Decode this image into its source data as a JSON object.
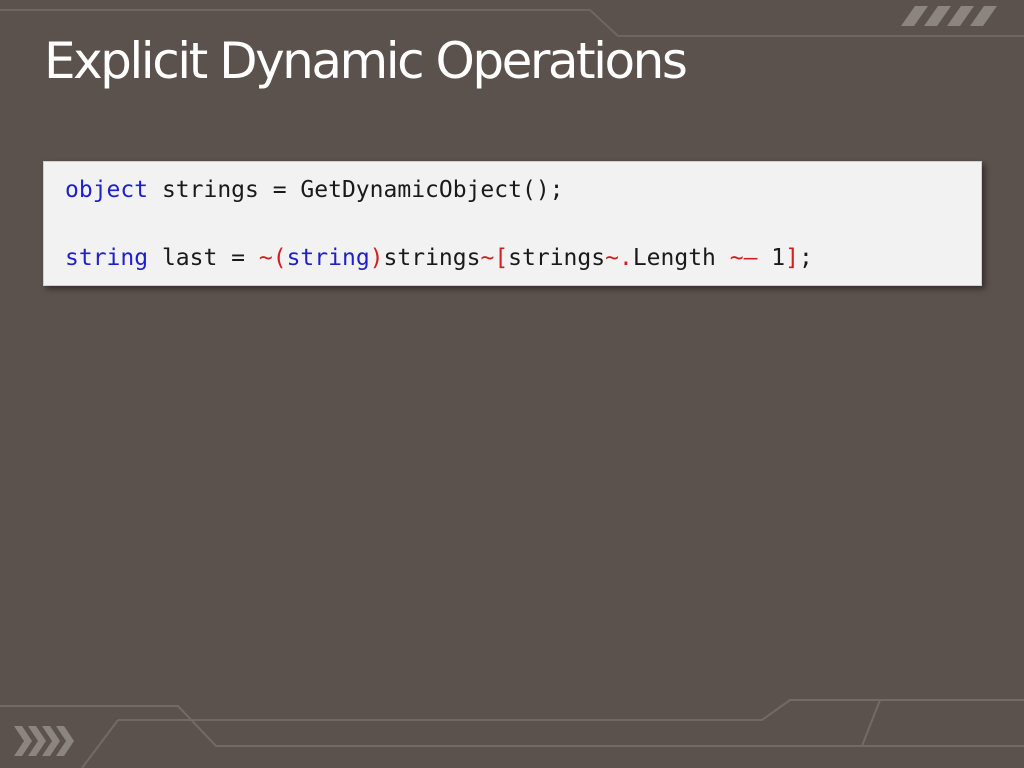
{
  "slide": {
    "title": "Explicit Dynamic Operations"
  },
  "code": {
    "line1": {
      "keyword": "object",
      "rest": " strings = GetDynamicObject();"
    },
    "line2": {
      "kw_string": "string",
      "t_last": " last = ",
      "op_tilde_paren": "~(",
      "kw_string_cast": "string",
      "op_close_paren": ")",
      "t_strings": "strings",
      "op_tilde_bracket": "~[",
      "t_strings2": "strings",
      "op_tilde_dot": "~.",
      "t_length": "Length ",
      "op_tilde_minus": "~–",
      "t_one": " 1",
      "op_close_bracket": "]",
      "t_semicolon": ";"
    }
  },
  "colors": {
    "background": "#5c524d",
    "keyword": "#1f1fcc",
    "dynamic_operator": "#d11f1f",
    "code_background": "#f2f2f2"
  }
}
